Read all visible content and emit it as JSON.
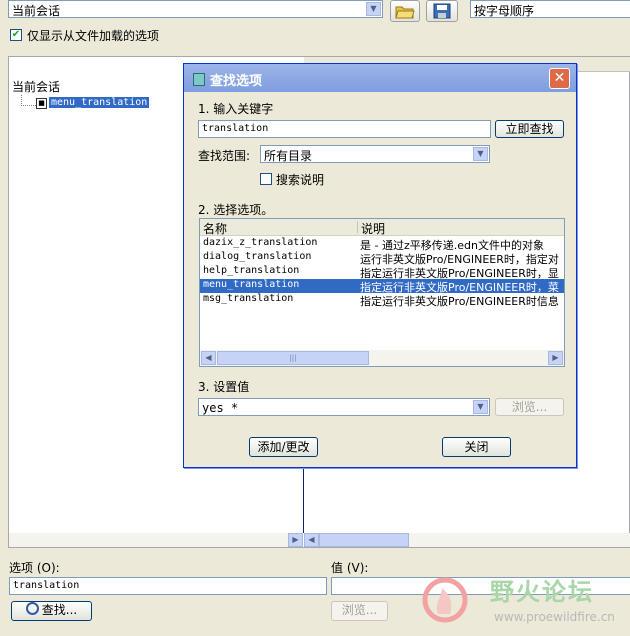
{
  "top": {
    "session_combo": "当前会话",
    "sort_combo": "按字母顺序",
    "show_loaded_label": "仅显示从文件加载的选项"
  },
  "tree": {
    "root_label": "当前会话",
    "child_label": "menu_translation"
  },
  "bottom": {
    "option_label": "选项 (O):",
    "value_label": "值 (V):",
    "option_value": "translation",
    "find_button": "查找...",
    "browse_button": "浏览..."
  },
  "dialog": {
    "title": "查找选项",
    "step1_label": "1.  输入关键字",
    "keyword_value": "translation",
    "search_now_button": "立即查找",
    "scope_label": "查找范围:",
    "scope_value": "所有目录",
    "search_desc_label": "搜索说明",
    "step2_label": "2.  选择选项。",
    "list_headers": {
      "name": "名称",
      "desc": "说明"
    },
    "list_rows": [
      {
        "name": "dazix_z_translation",
        "desc": "是 - 通过z平移传递.edn文件中的对象"
      },
      {
        "name": "dialog_translation",
        "desc": "运行非英文版Pro/ENGINEER时，指定对"
      },
      {
        "name": "help_translation",
        "desc": "指定运行非英文版Pro/ENGINEER时，显"
      },
      {
        "name": "menu_translation",
        "desc": "指定运行非英文版Pro/ENGINEER时，菜"
      },
      {
        "name": "msg_translation",
        "desc": "指定运行非英文版Pro/ENGINEER时信息"
      }
    ],
    "step3_label": "3.  设置值",
    "set_value": "yes *",
    "browse_button": "浏览...",
    "add_change_button": "添加/更改",
    "close_button": "关闭"
  },
  "watermark": {
    "title": "野火论坛",
    "url": "www.proewildfire.cn"
  },
  "colors": {
    "selection": "#316ac5",
    "title_bar": "#0a246a",
    "window_bg": "#ece9d8"
  }
}
